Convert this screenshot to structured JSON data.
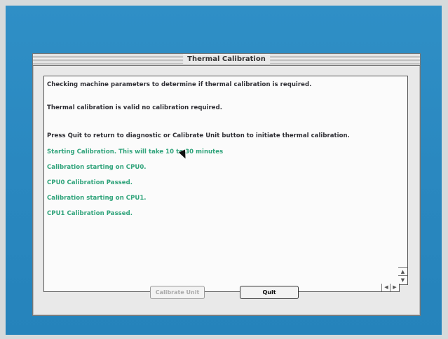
{
  "window": {
    "title": "Thermal Calibration"
  },
  "log": {
    "lines": [
      {
        "text": "Checking machine parameters to determine if thermal calibration is required.",
        "color": "#2d2d33"
      },
      {
        "text": "Thermal calibration is valid no calibration required.",
        "color": "#2d2d33"
      },
      {
        "text": "Press Quit to return to diagnostic or Calibrate Unit button to initiate thermal calibration.",
        "color": "#2d2d33"
      },
      {
        "text": "Starting Calibration. This will take 10 to 30 minutes",
        "color": "#2fa37a"
      },
      {
        "text": "Calibration starting on CPU0.",
        "color": "#2fa37a"
      },
      {
        "text": "CPU0 Calibration Passed.",
        "color": "#2fa37a"
      },
      {
        "text": "Calibration starting on CPU1.",
        "color": "#2fa37a"
      },
      {
        "text": "CPU1 Calibration Passed.",
        "color": "#2fa37a"
      }
    ]
  },
  "buttons": {
    "calibrate_label": "Calibrate Unit",
    "quit_label": "Quit"
  },
  "icons": {
    "scroll_up": "scroll-up-arrow-icon",
    "scroll_down": "scroll-down-arrow-icon",
    "scroll_left": "scroll-left-arrow-icon",
    "scroll_right": "scroll-right-arrow-icon",
    "cursor": "mouse-pointer-icon"
  }
}
